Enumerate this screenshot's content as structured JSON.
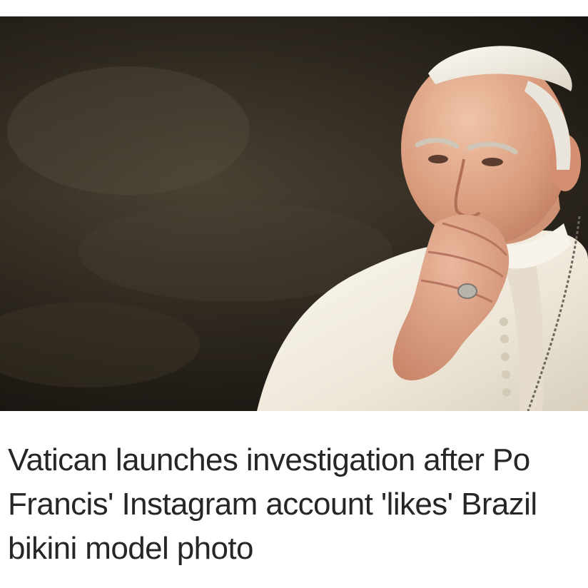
{
  "article": {
    "headline_lines": [
      "Vatican launches investigation after Po",
      "Francis' Instagram account 'likes' Brazil",
      "bikini model photo"
    ]
  },
  "photo": {
    "subject": "portrait-photo"
  },
  "colors": {
    "background": "#ffffff",
    "headline_text": "#262626",
    "photo_background": "#2f2a22",
    "vestment": "#f1ece0"
  }
}
